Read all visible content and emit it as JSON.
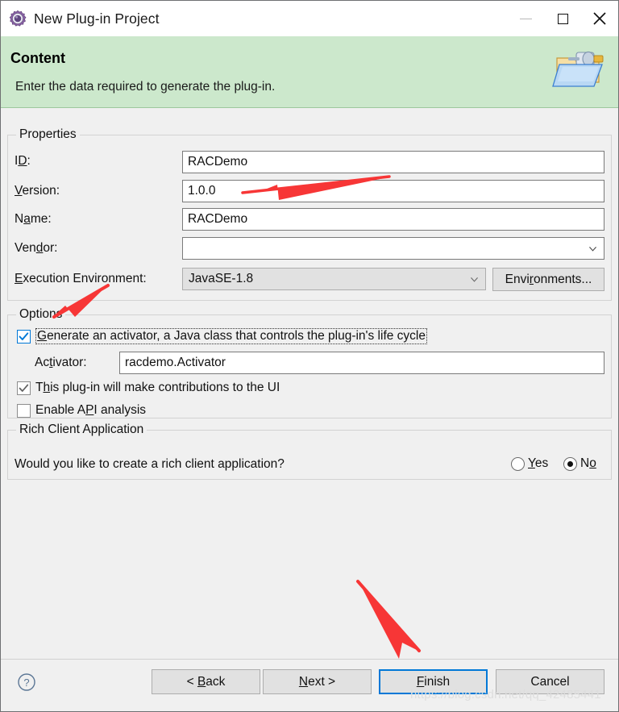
{
  "window": {
    "title": "New Plug-in Project",
    "icon": "plugin-gear-icon",
    "minimize_label": "—",
    "maximize_label": "□",
    "close_label": "✕"
  },
  "banner": {
    "title": "Content",
    "description": "Enter the data required to generate the plug-in.",
    "icon": "plugin-folder-icon",
    "background_color": "#cce8cc"
  },
  "properties": {
    "group_title": "Properties",
    "fields": [
      {
        "label_pre": "I",
        "label_mnemonic": "D",
        "label_post": ":",
        "value": "RACDemo",
        "type": "text"
      },
      {
        "label_pre": "",
        "label_mnemonic": "V",
        "label_post": "ersion:",
        "value": "1.0.0",
        "type": "text"
      },
      {
        "label_pre": "N",
        "label_mnemonic": "a",
        "label_post": "me:",
        "value": "RACDemo",
        "type": "text"
      },
      {
        "label_pre": "Ven",
        "label_mnemonic": "d",
        "label_post": "or:",
        "value": "",
        "type": "combo"
      }
    ],
    "exec_env": {
      "label_pre": "",
      "label_mnemonic": "E",
      "label_post": "xecution Environment:",
      "value": "JavaSE-1.8",
      "button_pre": "Envi",
      "button_mnemonic": "r",
      "button_post": "onments..."
    }
  },
  "options": {
    "group_title": "Options",
    "generate_activator": {
      "label_pre": "",
      "label_mnemonic": "G",
      "label_post": "enerate an activator, a Java class that controls the plug-in's life cycle",
      "checked": true,
      "focused": true
    },
    "activator": {
      "label_pre": "Ac",
      "label_mnemonic": "t",
      "label_post": "ivator:",
      "value": "racdemo.Activator"
    },
    "ui_contributions": {
      "label_pre": "T",
      "label_mnemonic": "h",
      "label_post": "is plug-in will make contributions to the UI",
      "checked": true,
      "focused": false
    },
    "api_analysis": {
      "label_pre": "Enable A",
      "label_mnemonic": "P",
      "label_post": "I analysis",
      "checked": false,
      "focused": false
    }
  },
  "rich_client": {
    "group_title": "Rich Client Application",
    "question": "Would you like to create a rich client application?",
    "yes": {
      "label_pre": "",
      "label_mnemonic": "Y",
      "label_post": "es",
      "selected": false
    },
    "no": {
      "label_pre": "N",
      "label_mnemonic": "o",
      "label_post": "",
      "selected": true
    }
  },
  "footer": {
    "help_icon": "help-question-icon",
    "buttons": [
      {
        "label_pre": "< ",
        "label_mnemonic": "B",
        "label_post": "ack",
        "name": "back-button",
        "default": false
      },
      {
        "label_pre": "",
        "label_mnemonic": "N",
        "label_post": "ext >",
        "name": "next-button",
        "default": false
      },
      {
        "label_pre": "",
        "label_mnemonic": "F",
        "label_post": "inish",
        "name": "finish-button",
        "default": true
      },
      {
        "label_pre": "Cancel",
        "label_mnemonic": "",
        "label_post": "",
        "name": "cancel-button",
        "default": false
      }
    ]
  },
  "annotations": {
    "arrow_color": "#f73636",
    "watermark": "https://blog.csdn.net/qq_42485441"
  }
}
